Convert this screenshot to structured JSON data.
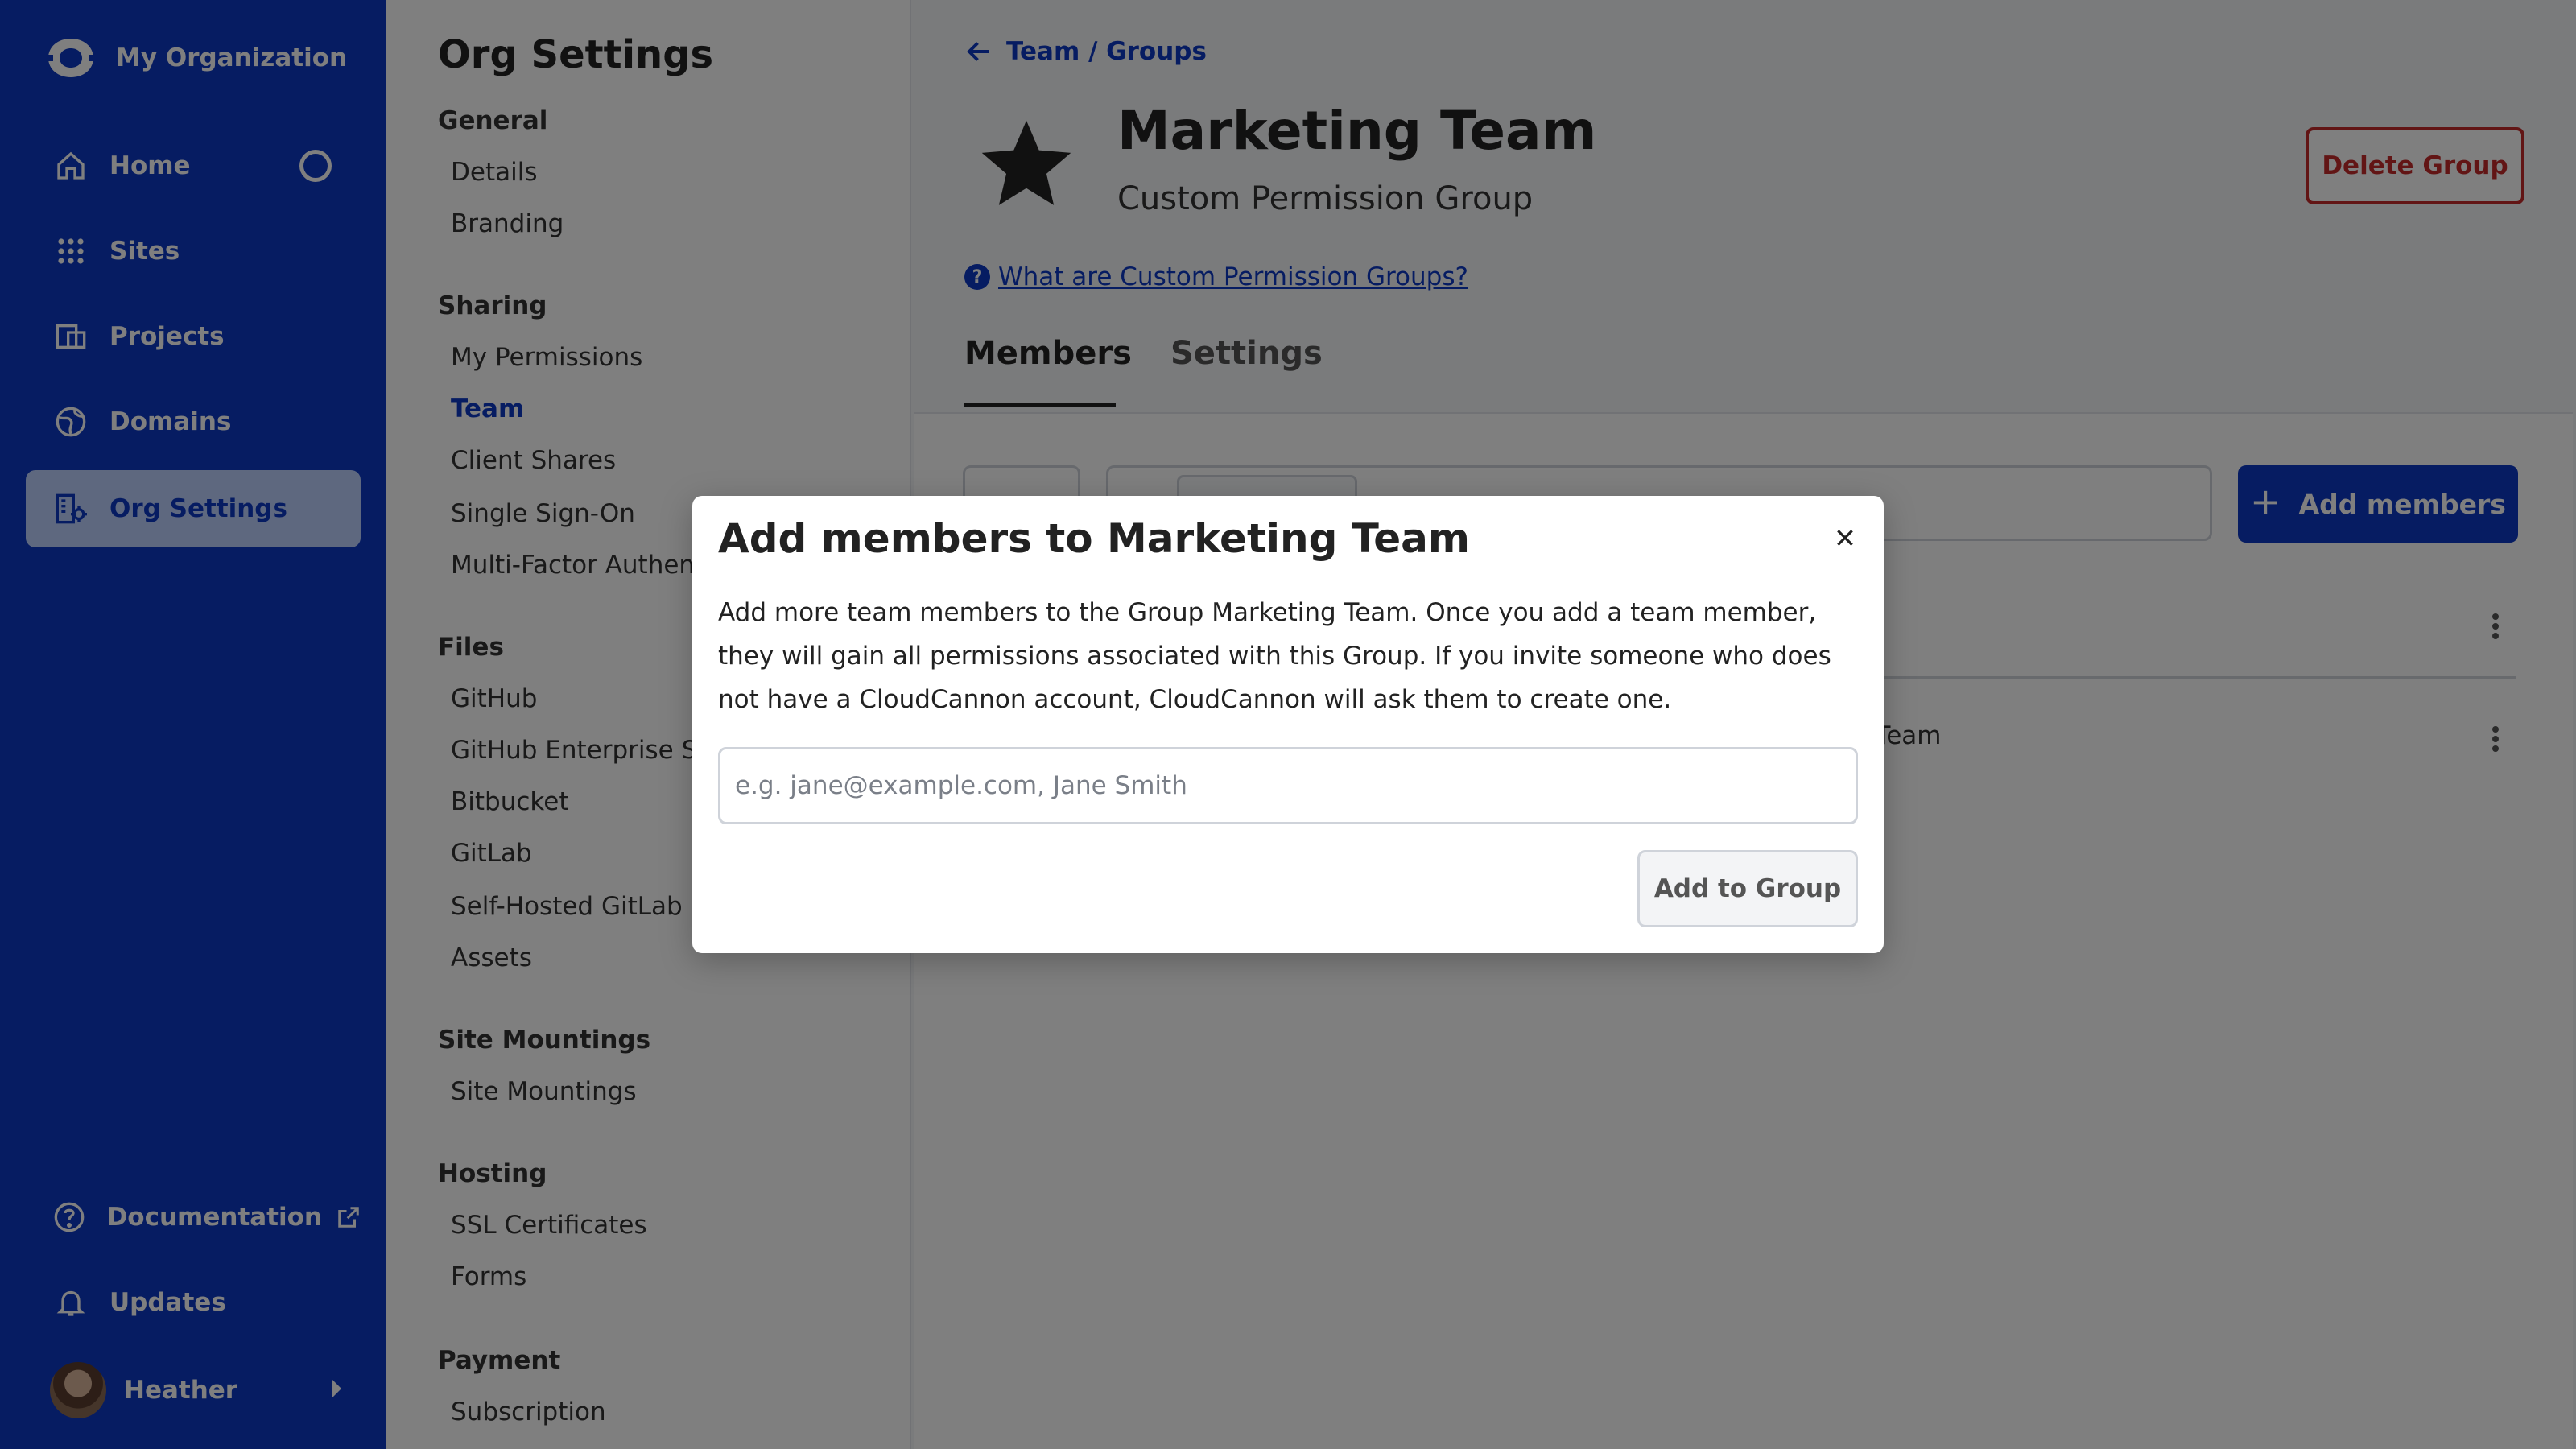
{
  "org": {
    "name": "My Organization"
  },
  "nav": {
    "home": "Home",
    "sites": "Sites",
    "projects": "Projects",
    "domains": "Domains",
    "org_settings": "Org Settings",
    "documentation": "Documentation",
    "updates": "Updates",
    "user": "Heather"
  },
  "settings": {
    "title": "Org Settings",
    "sections": [
      {
        "heading": "General",
        "items": [
          "Details",
          "Branding"
        ]
      },
      {
        "heading": "Sharing",
        "items": [
          "My Permissions",
          "Team",
          "Client Shares",
          "Single Sign-On",
          "Multi-Factor Authent"
        ]
      },
      {
        "heading": "Files",
        "items": [
          "GitHub",
          "GitHub Enterprise Se",
          "Bitbucket",
          "GitLab",
          "Self-Hosted GitLab",
          "Assets"
        ]
      },
      {
        "heading": "Site Mountings",
        "items": [
          "Site Mountings"
        ]
      },
      {
        "heading": "Hosting",
        "items": [
          "SSL Certificates",
          "Forms"
        ]
      },
      {
        "heading": "Payment",
        "items": [
          "Subscription"
        ]
      }
    ],
    "active_item": "Team"
  },
  "main": {
    "breadcrumb": "Team / Groups",
    "group_title": "Marketing Team",
    "group_subtitle": "Custom Permission Group",
    "delete_label": "Delete Group",
    "help_icon": "?",
    "help_link": "What are Custom Permission Groups?",
    "tabs": [
      "Members",
      "Settings"
    ],
    "add_members_label": "Add members",
    "row_text_fragment": "g Team"
  },
  "modal": {
    "title": "Add members to Marketing Team",
    "body": "Add more team members to the Group Marketing Team. Once you add a team member, they will gain all permissions associated with this Group. If you invite someone who does not have a CloudCannon account, CloudCannon will ask them to create one.",
    "input_placeholder": "e.g. jane@example.com, Jane Smith",
    "add_button": "Add to Group"
  },
  "colors": {
    "brand": "#0d38c4",
    "active_nav_bg": "#bcd1ff",
    "danger": "#c42b2b"
  }
}
